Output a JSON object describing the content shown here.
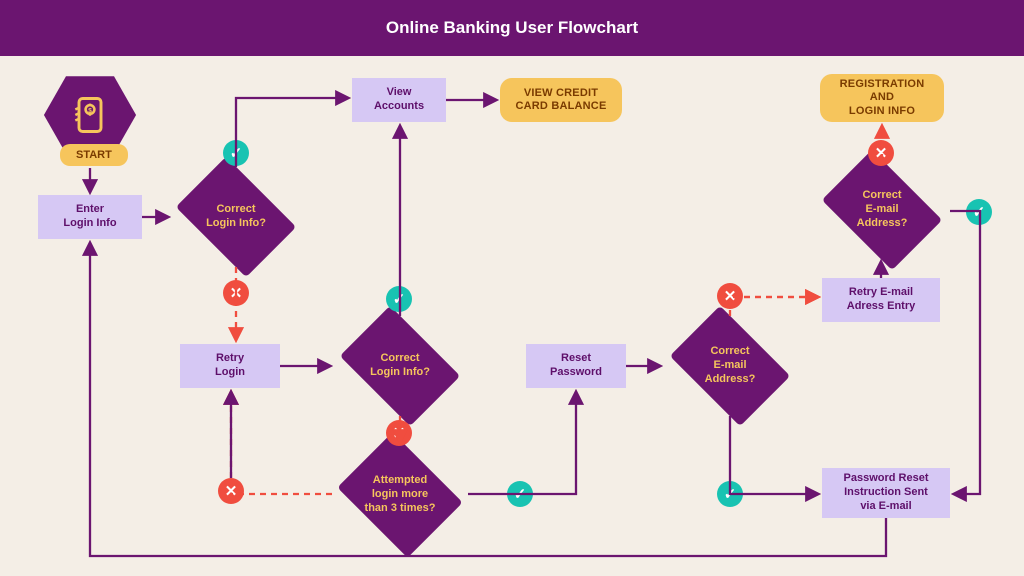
{
  "title": "Online Banking User Flowchart",
  "start": "START",
  "proc": {
    "enterLogin": "Enter\nLogin Info",
    "viewAccounts": "View\nAccounts",
    "retryLogin": "Retry\nLogin",
    "resetPassword": "Reset\nPassword",
    "retryEmail": "Retry E-mail\nAdress Entry",
    "pwResetSent": "Password Reset\nInstruction Sent\nvia E-mail"
  },
  "term": {
    "viewCredit": "VIEW CREDIT\nCARD BALANCE",
    "regLogin": "REGISTRATION\nAND\nLOGIN INFO"
  },
  "dec": {
    "correctLogin1": "Correct\nLogin Info?",
    "correctLogin2": "Correct\nLogin Info?",
    "attempt3": "Attempted\nlogin more\nthan 3 times?",
    "correctEmail1": "Correct\nE-mail\nAddress?",
    "correctEmail2": "Correct\nE-mail\nAddress?"
  }
}
